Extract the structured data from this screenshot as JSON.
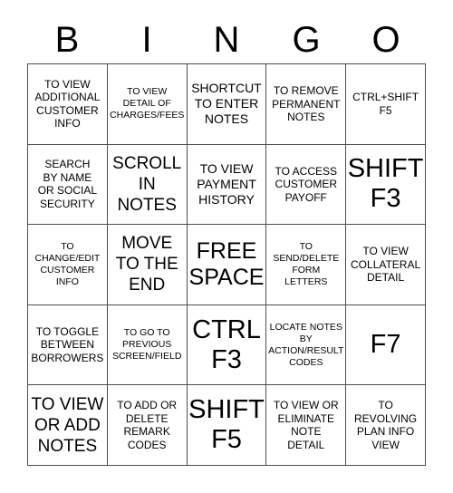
{
  "card": {
    "title": "BINGO",
    "header_letters": [
      "B",
      "I",
      "N",
      "G",
      "O"
    ],
    "free_space_label": "FREE\nSPACE",
    "colors": {
      "background": "#ffffff",
      "grid_line": "#4d4d4d",
      "text": "#000000"
    },
    "grid": {
      "columns": 5,
      "rows": 5,
      "cells": [
        {
          "text": "TO VIEW\nADDITIONAL\nCUSTOMER\nINFO",
          "size": "s",
          "column": "B",
          "row": 1
        },
        {
          "text": "TO VIEW\nDETAIL OF\nCHARGES/FEES",
          "size": "xs",
          "column": "I",
          "row": 1
        },
        {
          "text": "SHORTCUT\nTO ENTER\nNOTES",
          "size": "m",
          "column": "N",
          "row": 1
        },
        {
          "text": "TO REMOVE\nPERMANENT\nNOTES",
          "size": "s",
          "column": "G",
          "row": 1
        },
        {
          "text": "CTRL+SHIFT\nF5",
          "size": "s",
          "column": "O",
          "row": 1
        },
        {
          "text": "SEARCH\nBY NAME\nOR SOCIAL\nSECURITY",
          "size": "s",
          "column": "B",
          "row": 2
        },
        {
          "text": "SCROLL\nIN\nNOTES",
          "size": "l",
          "column": "I",
          "row": 2
        },
        {
          "text": "TO VIEW\nPAYMENT\nHISTORY",
          "size": "m",
          "column": "N",
          "row": 2
        },
        {
          "text": "TO ACCESS\nCUSTOMER\nPAYOFF",
          "size": "s",
          "column": "G",
          "row": 2
        },
        {
          "text": "SHIFT\nF3",
          "size": "xxl",
          "column": "O",
          "row": 2
        },
        {
          "text": "TO\nCHANGE/EDIT\nCUSTOMER\nINFO",
          "size": "xs",
          "column": "B",
          "row": 3
        },
        {
          "text": "MOVE\nTO THE\nEND",
          "size": "l",
          "column": "I",
          "row": 3
        },
        {
          "text": "FREE\nSPACE",
          "size": "xl",
          "column": "N",
          "row": 3
        },
        {
          "text": "TO\nSEND/DELETE\nFORM\nLETTERS",
          "size": "xs",
          "column": "G",
          "row": 3
        },
        {
          "text": "TO VIEW\nCOLLATERAL\nDETAIL",
          "size": "s",
          "column": "O",
          "row": 3
        },
        {
          "text": "TO TOGGLE\nBETWEEN\nBORROWERS",
          "size": "s",
          "column": "B",
          "row": 4
        },
        {
          "text": "TO GO TO\nPREVIOUS\nSCREEN/FIELD",
          "size": "xs",
          "column": "I",
          "row": 4
        },
        {
          "text": "CTRL\nF3",
          "size": "xxl",
          "column": "N",
          "row": 4
        },
        {
          "text": "LOCATE NOTES\nBY\nACTION/RESULT\nCODES",
          "size": "xs",
          "column": "G",
          "row": 4
        },
        {
          "text": "F7",
          "size": "xxl",
          "column": "O",
          "row": 4
        },
        {
          "text": "TO VIEW\nOR ADD\nNOTES",
          "size": "l",
          "column": "B",
          "row": 5
        },
        {
          "text": "TO ADD OR\nDELETE\nREMARK\nCODES",
          "size": "s",
          "column": "I",
          "row": 5
        },
        {
          "text": "SHIFT\nF5",
          "size": "xxl",
          "column": "N",
          "row": 5
        },
        {
          "text": "TO VIEW OR\nELIMINATE\nNOTE\nDETAIL",
          "size": "s",
          "column": "G",
          "row": 5
        },
        {
          "text": "TO\nREVOLVING\nPLAN INFO\nVIEW",
          "size": "s",
          "column": "O",
          "row": 5
        }
      ]
    }
  }
}
